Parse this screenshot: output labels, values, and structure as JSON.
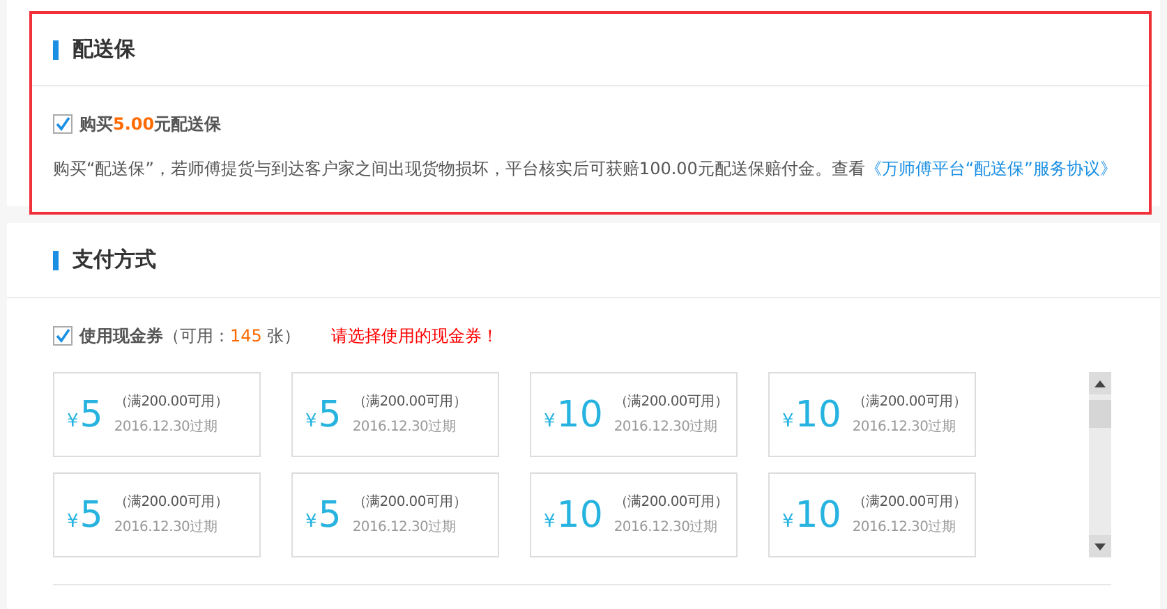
{
  "delivery_insurance": {
    "title": "配送保",
    "option": {
      "checked": true,
      "label": "购买**5.00**元配送保"
    },
    "description": "购买“配送保”，若师傅提货与到达客户家之间出现货物损坏，平台核实后可获赔100.00元配送保赔付金。查看",
    "agreement_link": "《万师傅平台“配送保”服务协议》"
  },
  "payment": {
    "title": "支付方式",
    "voucher_option": {
      "checked": true,
      "label": "使用现金券",
      "available_prefix": "（可用：",
      "available_count": "145",
      "available_suffix": " 张）"
    },
    "warning": "请选择使用的现金券！",
    "coupons": [
      {
        "currency": "¥",
        "amount": "5",
        "condition": "（满200.00可用）",
        "expiry": "2016.12.30过期"
      },
      {
        "currency": "¥",
        "amount": "5",
        "condition": "（满200.00可用）",
        "expiry": "2016.12.30过期"
      },
      {
        "currency": "¥",
        "amount": "10",
        "condition": "（满200.00可用）",
        "expiry": "2016.12.30过期"
      },
      {
        "currency": "¥",
        "amount": "10",
        "condition": "（满200.00可用）",
        "expiry": "2016.12.30过期"
      },
      {
        "currency": "¥",
        "amount": "5",
        "condition": "（满200.00可用）",
        "expiry": "2016.12.30过期"
      },
      {
        "currency": "¥",
        "amount": "5",
        "condition": "（满200.00可用）",
        "expiry": "2016.12.30过期"
      },
      {
        "currency": "¥",
        "amount": "10",
        "condition": "（满200.00可用）",
        "expiry": "2016.12.30过期"
      },
      {
        "currency": "¥",
        "amount": "10",
        "condition": "（满200.00可用）",
        "expiry": "2016.12.30过期"
      }
    ]
  }
}
